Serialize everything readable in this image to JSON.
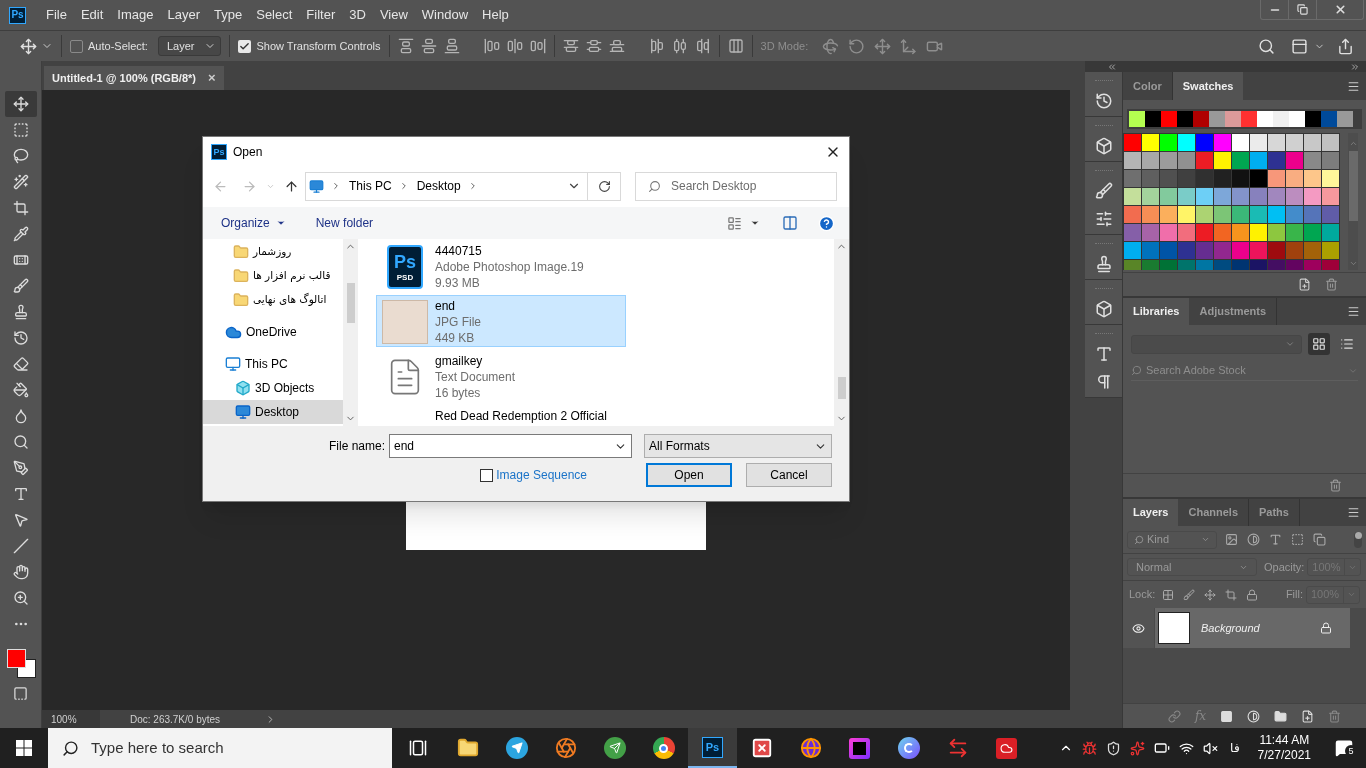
{
  "app": {
    "logo": "Ps",
    "menu": [
      "File",
      "Edit",
      "Image",
      "Layer",
      "Type",
      "Select",
      "Filter",
      "3D",
      "View",
      "Window",
      "Help"
    ]
  },
  "options_bar": {
    "auto_select": {
      "label": "Auto-Select:",
      "checked": false
    },
    "target": "Layer",
    "transform_controls": {
      "label": "Show Transform Controls",
      "checked": true
    },
    "mode_label": "3D Mode:"
  },
  "document": {
    "tab": "Untitled-1 @ 100% (RGB/8*)",
    "close": "×",
    "zoom": "100%",
    "doc_info": "Doc: 263.7K/0 bytes"
  },
  "tools": {
    "colors": [
      {
        "color": "#ff0000"
      },
      {
        "color": "#ffffff"
      }
    ]
  },
  "dialog": {
    "logo": "Ps",
    "title": "Open",
    "breadcrumb": [
      "This PC",
      "Desktop"
    ],
    "search": {
      "placeholder": "Search Desktop"
    },
    "organize": "Organize",
    "new_folder": "New folder",
    "nav": [
      {
        "label": "روزشمار",
        "kind": "folder",
        "selected": false
      },
      {
        "label": "قالب نرم افزار ها",
        "kind": "folder",
        "selected": false
      },
      {
        "label": "اتالوگ های نهایی",
        "kind": "folder",
        "selected": false
      },
      {
        "label": "OneDrive",
        "kind": "cloud",
        "selected": false
      },
      {
        "label": "This PC",
        "kind": "pc",
        "selected": false,
        "children": [
          {
            "label": "3D Objects",
            "kind": "objects",
            "selected": false
          },
          {
            "label": "Desktop",
            "kind": "desktop",
            "selected": true
          }
        ]
      }
    ],
    "files": [
      {
        "name": "4440715",
        "type": "Adobe Photoshop Image.19",
        "size": "9.93 MB",
        "kind": "psd",
        "icon_text": [
          "Ps",
          "PSD"
        ],
        "selected": false
      },
      {
        "name": "end",
        "type": "JPG File",
        "size": "449 KB",
        "kind": "image",
        "selected": true
      },
      {
        "name": "gmailkey",
        "type": "Text Document",
        "size": "16 bytes",
        "kind": "text",
        "selected": false
      },
      {
        "name": "Red Dead Redemption 2 Official",
        "kind": "video",
        "selected": false
      }
    ],
    "file_name": {
      "label": "File name:",
      "value": "end"
    },
    "filter": "All Formats",
    "image_sequence": {
      "label": "Image Sequence",
      "checked": false
    },
    "buttons": [
      {
        "label": "Open",
        "default": true
      },
      {
        "label": "Cancel",
        "default": false
      }
    ]
  },
  "color_panel": {
    "tabs": [
      {
        "label": "Color",
        "selected": false
      },
      {
        "label": "Swatches",
        "selected": true
      }
    ],
    "recent": [
      {
        "color": "#b4ff50"
      },
      {
        "color": "#000000"
      },
      {
        "color": "#ff0000"
      },
      {
        "color": "#000000"
      },
      {
        "color": "#b00000"
      },
      {
        "color": "#999999"
      },
      {
        "color": "#dc9a9a"
      },
      {
        "color": "#ff3030"
      },
      {
        "color": "#ffffff"
      },
      {
        "color": "#f0f0f0"
      },
      {
        "color": "#ffffff"
      },
      {
        "color": "#000000"
      },
      {
        "color": "#004a9a"
      },
      {
        "color": "#999999"
      }
    ],
    "swatches": [
      [
        {
          "color": "#ff0000"
        },
        {
          "color": "#ffff00"
        },
        {
          "color": "#00ff00"
        },
        {
          "color": "#00ffff"
        },
        {
          "color": "#0000ff"
        },
        {
          "color": "#ff00ff"
        },
        {
          "color": "#ffffff"
        },
        {
          "color": "#ebebeb"
        },
        {
          "color": "#d7d7d7"
        },
        {
          "color": "#d0d0d0"
        },
        {
          "color": "#c8c8c8"
        },
        {
          "color": "#c0c0c0"
        }
      ],
      [
        {
          "color": "#b4b4b4"
        },
        {
          "color": "#a8a8a8"
        },
        {
          "color": "#9c9c9c"
        },
        {
          "color": "#909090"
        },
        {
          "color": "#ed1c24"
        },
        {
          "color": "#fff200"
        },
        {
          "color": "#00a651"
        },
        {
          "color": "#00aeef"
        },
        {
          "color": "#2e3192"
        },
        {
          "color": "#ec008c"
        },
        {
          "color": "#898989"
        },
        {
          "color": "#7d7d7d"
        }
      ],
      [
        {
          "color": "#6f6f6f"
        },
        {
          "color": "#5f5f5f"
        },
        {
          "color": "#505050"
        },
        {
          "color": "#404040"
        },
        {
          "color": "#303030"
        },
        {
          "color": "#212121"
        },
        {
          "color": "#111111"
        },
        {
          "color": "#000000"
        },
        {
          "color": "#f7977a"
        },
        {
          "color": "#f9ad81"
        },
        {
          "color": "#fdc68a"
        },
        {
          "color": "#fff79a"
        }
      ],
      [
        {
          "color": "#c4df9b"
        },
        {
          "color": "#a3d39c"
        },
        {
          "color": "#82ca9d"
        },
        {
          "color": "#7accc8"
        },
        {
          "color": "#6dcff6"
        },
        {
          "color": "#7da7d9"
        },
        {
          "color": "#8393ca"
        },
        {
          "color": "#8781bd"
        },
        {
          "color": "#a187be"
        },
        {
          "color": "#bc8dbf"
        },
        {
          "color": "#f49ac2"
        },
        {
          "color": "#f6989d"
        }
      ],
      [
        {
          "color": "#f26c4f"
        },
        {
          "color": "#f68e55"
        },
        {
          "color": "#fbaf5c"
        },
        {
          "color": "#fff467"
        },
        {
          "color": "#acd372"
        },
        {
          "color": "#7cc576"
        },
        {
          "color": "#3bb878"
        },
        {
          "color": "#1abbb4"
        },
        {
          "color": "#00bff3"
        },
        {
          "color": "#438ccb"
        },
        {
          "color": "#5574b9"
        },
        {
          "color": "#605ca8"
        }
      ],
      [
        {
          "color": "#855fa8"
        },
        {
          "color": "#a763a8"
        },
        {
          "color": "#f06eaa"
        },
        {
          "color": "#f26d7d"
        },
        {
          "color": "#ed1c24"
        },
        {
          "color": "#f26522"
        },
        {
          "color": "#f7941d"
        },
        {
          "color": "#fff200"
        },
        {
          "color": "#8dc73f"
        },
        {
          "color": "#39b54a"
        },
        {
          "color": "#00a651"
        },
        {
          "color": "#00a99d"
        }
      ],
      [
        {
          "color": "#00aeef"
        },
        {
          "color": "#0072bc"
        },
        {
          "color": "#0054a6"
        },
        {
          "color": "#2e3192"
        },
        {
          "color": "#662d91"
        },
        {
          "color": "#92278f"
        },
        {
          "color": "#ec008c"
        },
        {
          "color": "#ed145b"
        },
        {
          "color": "#9e0b0f"
        },
        {
          "color": "#a0410d"
        },
        {
          "color": "#a36209"
        },
        {
          "color": "#aba000"
        }
      ],
      [
        {
          "color": "#598527"
        },
        {
          "color": "#1a7b30"
        },
        {
          "color": "#007236"
        },
        {
          "color": "#00746b"
        },
        {
          "color": "#0076a3"
        },
        {
          "color": "#004b80"
        },
        {
          "color": "#003471"
        },
        {
          "color": "#1b1464"
        },
        {
          "color": "#440e62"
        },
        {
          "color": "#630460"
        },
        {
          "color": "#9e005d"
        },
        {
          "color": "#9e0039"
        }
      ]
    ]
  },
  "libraries_panel": {
    "tabs": [
      {
        "label": "Libraries",
        "selected": true
      },
      {
        "label": "Adjustments",
        "selected": false
      }
    ],
    "search": {
      "placeholder": "Search Adobe Stock"
    },
    "views": [
      {
        "kind": "grid",
        "selected": true
      },
      {
        "kind": "list",
        "selected": false
      }
    ]
  },
  "layers_panel": {
    "tabs": [
      {
        "label": "Layers",
        "selected": true
      },
      {
        "label": "Channels",
        "selected": false
      },
      {
        "label": "Paths",
        "selected": false
      }
    ],
    "filter": "Kind",
    "blend_mode": "Normal",
    "opacity_label": "Opacity:",
    "opacity": "100%",
    "lock_label": "Lock:",
    "fill_label": "Fill:",
    "fill": "100%",
    "effects": "fx",
    "layers": [
      {
        "name": "Background",
        "visible": true,
        "locked": true,
        "selected": true
      }
    ]
  },
  "taskbar": {
    "search": {
      "placeholder": "Type here to search"
    },
    "apps": [
      {
        "kind": "explorer",
        "selected": false
      },
      {
        "kind": "telegram",
        "selected": false
      },
      {
        "kind": "swirl",
        "selected": false
      },
      {
        "kind": "send",
        "selected": false
      },
      {
        "kind": "chrome",
        "selected": false
      },
      {
        "kind": "photoshop",
        "label": "Ps",
        "selected": true
      },
      {
        "kind": "xsquare",
        "selected": false
      },
      {
        "kind": "firefox",
        "selected": false
      },
      {
        "kind": "purple",
        "selected": false
      },
      {
        "kind": "cbrowser",
        "selected": false
      },
      {
        "kind": "transfer",
        "selected": false
      },
      {
        "kind": "cloud",
        "selected": false
      }
    ],
    "language": "فا",
    "time": "11:44 AM",
    "date": "7/27/2021",
    "notifications": "5"
  }
}
